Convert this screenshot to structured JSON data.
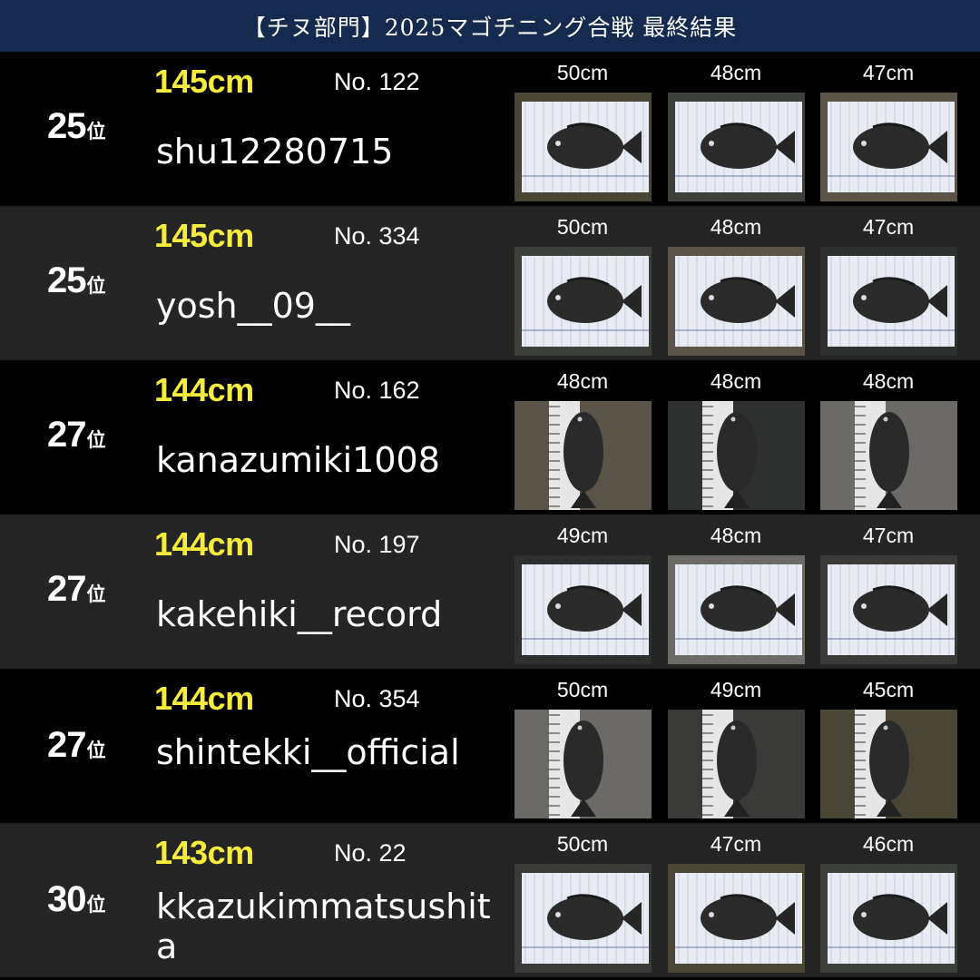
{
  "header": {
    "title": "【チヌ部門】2025マゴチニング合戦 最終結果"
  },
  "rank_suffix": "位",
  "rows": [
    {
      "rank": "25",
      "total": "145cm",
      "entry": "No. 122",
      "user": "shu12280715",
      "fish": [
        {
          "size": "50cm",
          "photo": "fish-on-measure-board"
        },
        {
          "size": "48cm",
          "photo": "fish-on-measure-board"
        },
        {
          "size": "47cm",
          "photo": "fish-on-measure-board"
        }
      ]
    },
    {
      "rank": "25",
      "total": "145cm",
      "entry": "No. 334",
      "user": "yosh__09__",
      "fish": [
        {
          "size": "50cm",
          "photo": "fish-on-measure-board"
        },
        {
          "size": "48cm",
          "photo": "fish-on-measure-board"
        },
        {
          "size": "47cm",
          "photo": "fish-on-measure-board"
        }
      ]
    },
    {
      "rank": "27",
      "total": "144cm",
      "entry": "No. 162",
      "user": "kanazumiki1008",
      "fish": [
        {
          "size": "48cm",
          "photo": "fish-on-measure-board"
        },
        {
          "size": "48cm",
          "photo": "fish-on-measure-board"
        },
        {
          "size": "48cm",
          "photo": "fish-on-measure-board"
        }
      ]
    },
    {
      "rank": "27",
      "total": "144cm",
      "entry": "No. 197",
      "user": "kakehiki__record",
      "fish": [
        {
          "size": "49cm",
          "photo": "fish-on-measure-board"
        },
        {
          "size": "48cm",
          "photo": "fish-on-measure-board"
        },
        {
          "size": "47cm",
          "photo": "fish-on-measure-board"
        }
      ]
    },
    {
      "rank": "27",
      "total": "144cm",
      "entry": "No. 354",
      "user": "shintekki__official",
      "fish": [
        {
          "size": "50cm",
          "photo": "fish-on-measure-board"
        },
        {
          "size": "49cm",
          "photo": "fish-on-measure-board"
        },
        {
          "size": "45cm",
          "photo": "fish-on-measure-board"
        }
      ]
    },
    {
      "rank": "30",
      "total": "143cm",
      "entry": "No. 22",
      "user": "kkazukimmatsushita",
      "fish": [
        {
          "size": "50cm",
          "photo": "fish-on-measure-board"
        },
        {
          "size": "47cm",
          "photo": "fish-on-measure-board"
        },
        {
          "size": "46cm",
          "photo": "fish-on-measure-board"
        }
      ]
    }
  ],
  "colors": {
    "header_bg": "#142a4e",
    "total_yellow": "#f6ec3c",
    "row_dark": "#000000",
    "row_grey": "#252525"
  }
}
